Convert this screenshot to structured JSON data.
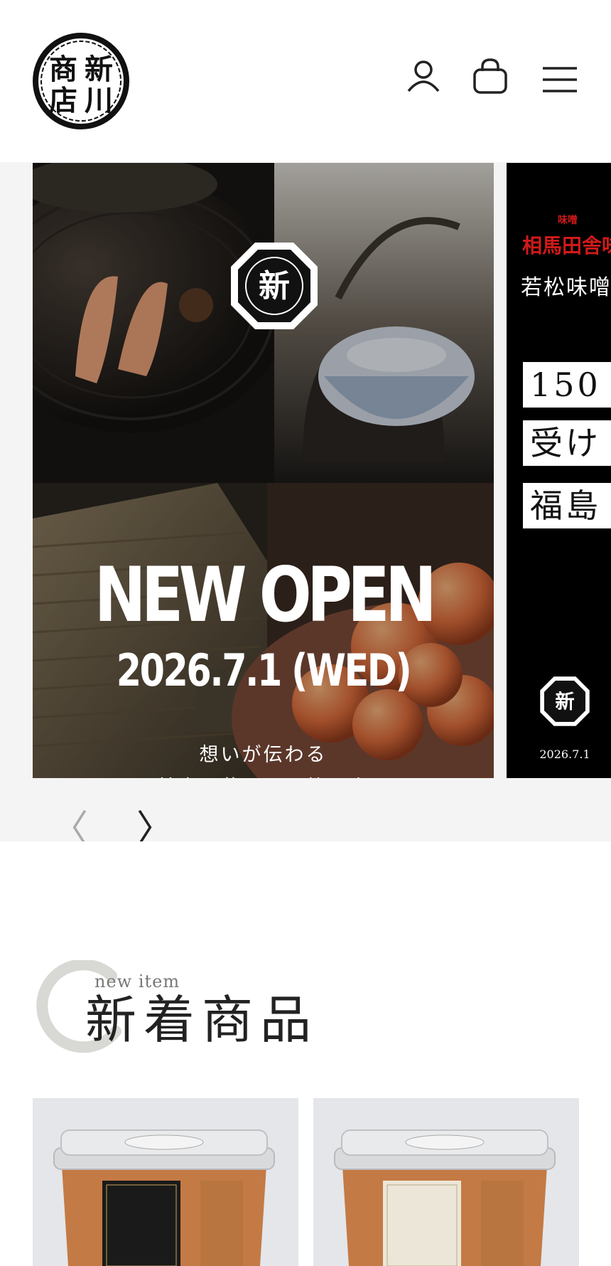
{
  "header": {
    "logo_text": [
      "商",
      "新",
      "店",
      "川"
    ],
    "icons": [
      "account-icon",
      "cart-icon",
      "menu-icon"
    ]
  },
  "slider": {
    "main": {
      "badge": "新",
      "title": "NEW OPEN",
      "date": "2026.7.1 (WED)",
      "tagline_1": "想いが伝わる",
      "tagline_2": "美食と暮らしの銘品店"
    },
    "next": {
      "brand_small": "味噌",
      "brand": "相馬田舎味",
      "sub": "若松味噌",
      "box_1": "150",
      "box_2": "受け",
      "box_3": "福島",
      "badge": "新",
      "date": "2026.7.1"
    },
    "prev_label": "〈",
    "next_label": "〉"
  },
  "new_items": {
    "subtitle": "new item",
    "title": "新着商品"
  },
  "colors": {
    "accent_red": "#d01a1a",
    "text": "#222222"
  }
}
